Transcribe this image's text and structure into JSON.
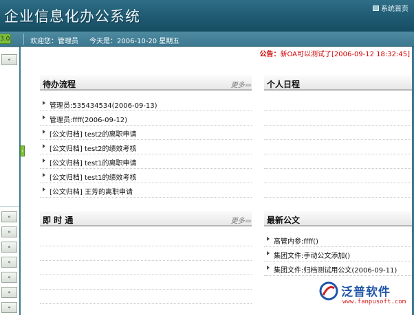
{
  "header": {
    "title": "企业信息化办公系统",
    "home_label": "系统首页"
  },
  "statusbar": {
    "version": "3.0",
    "welcome": "欢迎您：管理员",
    "today": "今天是：2006-10-20 星期五"
  },
  "notice": {
    "label": "公告：",
    "text": "新OA可以测试了[2006-09-12 18:32:45]"
  },
  "sidebar": {
    "collapse_glyph": "«",
    "toggle_glyph": "›"
  },
  "panels": {
    "todo": {
      "title": "待办流程",
      "more": "更多",
      "items": [
        "管理员:535434534(2006-09-13)",
        " 管理员:ffff(2006-09-12)",
        "[公文归档] test2的离职申请",
        "[公文归档] test2的绩效考核",
        "[公文归档] test1的离职申请",
        "[公文归档] test1的绩效考核",
        "[公文归档] 王芳的离职申请"
      ]
    },
    "schedule": {
      "title": "个人日程"
    },
    "instant": {
      "title": "即 时 通",
      "more": "更多"
    },
    "docs": {
      "title": "最新公文",
      "items": [
        "高管内参:ffff()",
        "集团文件:手动公文添加()",
        "集团文件:归档测试用公文(2006-09-11)"
      ]
    }
  },
  "logo": {
    "name": "泛普软件",
    "url": "www.fanpusoft.com"
  },
  "colors": {
    "header": "#1f5a72",
    "notice": "#d00000",
    "accent_green": "#7fbf3d"
  }
}
